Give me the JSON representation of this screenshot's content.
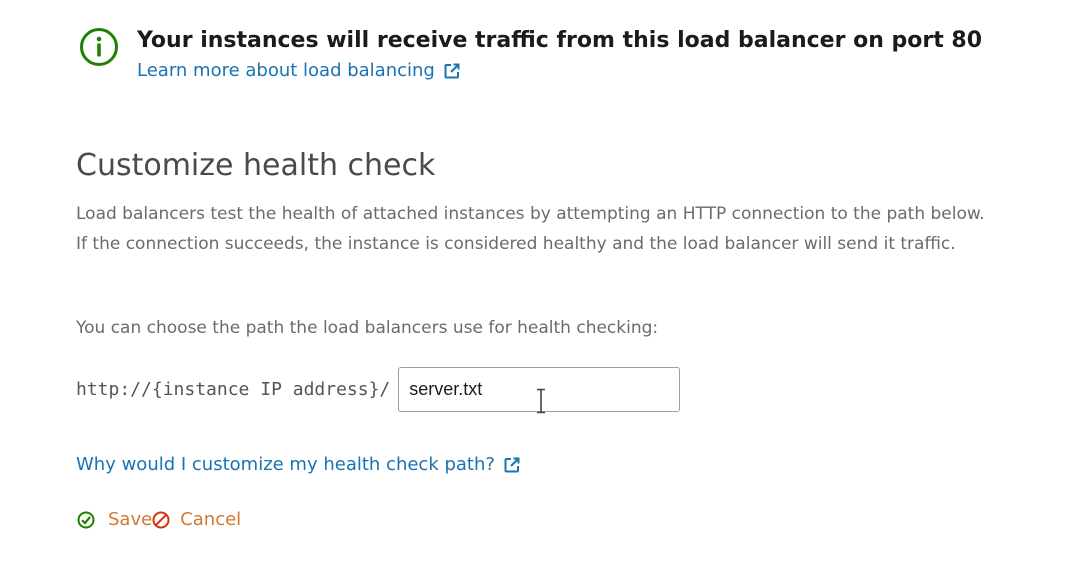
{
  "notice": {
    "title": "Your instances will receive traffic from this load balancer on port 80",
    "link_label": "Learn more about load balancing"
  },
  "section": {
    "title": "Customize health check",
    "description": "Load balancers test the health of attached instances by attempting an HTTP connection to the path below. If the connection succeeds, the instance is considered healthy and the load balancer will send it traffic.",
    "choose_text": "You can choose the path the load balancers use for health checking:",
    "path_prefix": "http://{instance IP address}/",
    "path_value": "server.txt",
    "why_link_label": "Why would I customize my health check path?"
  },
  "actions": {
    "save_label": "Save",
    "cancel_label": "Cancel"
  },
  "icons": {
    "info": "info-circle-icon",
    "external": "external-link-icon",
    "save": "check-circle-icon",
    "cancel": "cancel-circle-icon"
  },
  "colors": {
    "success_green": "#1d8102",
    "link_blue": "#1a73b0",
    "action_orange": "#d4782c"
  }
}
